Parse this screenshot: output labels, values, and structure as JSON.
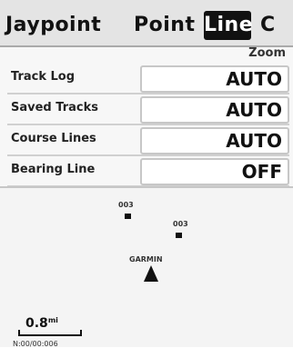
{
  "tabs": {
    "waypoint": "Jaypoint",
    "point": "Point",
    "line": "Line",
    "next": "C"
  },
  "zoom_header": "Zoom",
  "settings": [
    {
      "label": "Track Log",
      "value": "AUTO"
    },
    {
      "label": "Saved Tracks",
      "value": "AUTO"
    },
    {
      "label": "Course Lines",
      "value": "AUTO"
    },
    {
      "label": "Bearing Line",
      "value": "OFF"
    }
  ],
  "map": {
    "waypoint_a": "003",
    "waypoint_b": "003",
    "current_label": "GARMIN",
    "scale": "0.8",
    "scale_unit": "mi",
    "footer": "N:00/00:006"
  }
}
